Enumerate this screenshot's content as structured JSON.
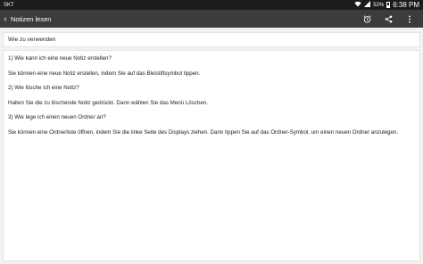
{
  "status": {
    "carrier": "SKT",
    "battery": "52%",
    "time": "6:38 PM"
  },
  "appbar": {
    "title": "Notizen lesen",
    "actions": [
      {
        "icon": "alarm-icon"
      },
      {
        "icon": "share-icon"
      },
      {
        "icon": "more-vert-icon"
      }
    ]
  },
  "note": {
    "title": "Wie zu verwenden",
    "paragraphs": [
      "1) Wie kann ich eine neue Notiz erstellen?",
      "Sie können eine neue Notiz erstellen, indem Sie auf das Bleistiftsymbol tippen.",
      "2) Wie lösche ich eine Notiz?",
      "Halten Sie die zu löschende Notiz gedrückt. Dann wählen Sie das Menü Löschen.",
      "3) Wie lege ich einen neuen Ordner an?",
      "Sie können eine Ordnerliste öffnen, indem Sie die linke Seite des Displays ziehen. Dann tippen Sie auf das Ordner-Symbol, um einen neuen Ordner anzulegen."
    ]
  }
}
